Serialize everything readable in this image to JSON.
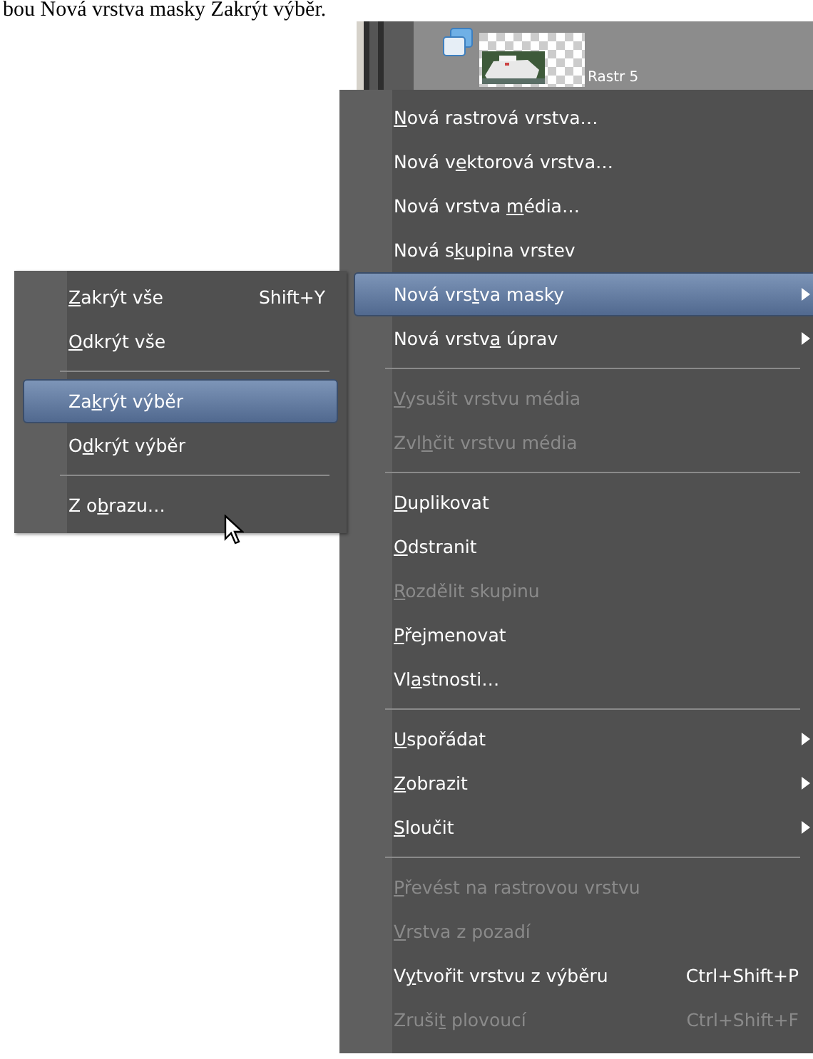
{
  "document_text": "bou Nová vrstva masky Zakrýt výběr.",
  "layer": {
    "name": "Rastr 5"
  },
  "context_menu": {
    "items": [
      {
        "kind": "item",
        "label": {
          "key": "N",
          "after": "ová rastrová vrstva…"
        },
        "disabled": false,
        "selected": false,
        "submenu": false
      },
      {
        "kind": "item",
        "label": {
          "before": "Nová v",
          "key": "e",
          "after": "ktorová vrstva…"
        },
        "disabled": false,
        "selected": false,
        "submenu": false
      },
      {
        "kind": "item",
        "label": {
          "before": "Nová vrstva ",
          "key": "m",
          "after": "édia…"
        },
        "disabled": false,
        "selected": false,
        "submenu": false
      },
      {
        "kind": "item",
        "label": {
          "before": "Nová s",
          "key": "k",
          "after": "upina vrstev"
        },
        "disabled": false,
        "selected": false,
        "submenu": false
      },
      {
        "kind": "item",
        "label": {
          "before": "Nová vrs",
          "key": "t",
          "after": "va masky"
        },
        "disabled": false,
        "selected": true,
        "submenu": true
      },
      {
        "kind": "item",
        "label": {
          "before": "Nová vrstv",
          "key": "a",
          "after": " úprav"
        },
        "disabled": false,
        "selected": false,
        "submenu": true
      },
      {
        "kind": "separator"
      },
      {
        "kind": "item",
        "label": {
          "key": "V",
          "after": "ysušit vrstvu média"
        },
        "disabled": true,
        "selected": false,
        "submenu": false
      },
      {
        "kind": "item",
        "label": {
          "before": "Zvl",
          "key": "h",
          "after": "čit vrstvu média"
        },
        "disabled": true,
        "selected": false,
        "submenu": false
      },
      {
        "kind": "separator"
      },
      {
        "kind": "item",
        "label": {
          "key": "D",
          "after": "uplikovat"
        },
        "disabled": false,
        "selected": false,
        "submenu": false
      },
      {
        "kind": "item",
        "label": {
          "key": "O",
          "after": "dstranit"
        },
        "disabled": false,
        "selected": false,
        "submenu": false
      },
      {
        "kind": "item",
        "label": {
          "key": "R",
          "after": "ozdělit skupinu"
        },
        "disabled": true,
        "selected": false,
        "submenu": false
      },
      {
        "kind": "item",
        "label": {
          "key": "P",
          "after": "řejmenovat"
        },
        "disabled": false,
        "selected": false,
        "submenu": false
      },
      {
        "kind": "item",
        "label": {
          "before": "Vl",
          "key": "a",
          "after": "stnosti…"
        },
        "disabled": false,
        "selected": false,
        "submenu": false
      },
      {
        "kind": "separator"
      },
      {
        "kind": "item",
        "label": {
          "key": "U",
          "after": "spořádat"
        },
        "disabled": false,
        "selected": false,
        "submenu": true
      },
      {
        "kind": "item",
        "label": {
          "key": "Z",
          "after": "obrazit"
        },
        "disabled": false,
        "selected": false,
        "submenu": true
      },
      {
        "kind": "item",
        "label": {
          "key": "S",
          "after": "loučit"
        },
        "disabled": false,
        "selected": false,
        "submenu": true
      },
      {
        "kind": "separator"
      },
      {
        "kind": "item",
        "label": {
          "key": "P",
          "after": "řevést na rastrovou vrstvu"
        },
        "disabled": true,
        "selected": false,
        "submenu": false
      },
      {
        "kind": "item",
        "label": {
          "key": "V",
          "after": "rstva z pozadí"
        },
        "disabled": true,
        "selected": false,
        "submenu": false
      },
      {
        "kind": "item",
        "label": {
          "before": "V",
          "key": "y",
          "after": "tvořit vrstvu z výběru"
        },
        "shortcut": "Ctrl+Shift+P",
        "disabled": false,
        "selected": false,
        "submenu": false
      },
      {
        "kind": "item",
        "label": {
          "before": "Zruši",
          "key": "t",
          "after": " plovoucí"
        },
        "shortcut": "Ctrl+Shift+F",
        "disabled": true,
        "selected": false,
        "submenu": false
      }
    ]
  },
  "submenu": {
    "items": [
      {
        "kind": "item",
        "label": {
          "key": "Z",
          "after": "akrýt vše"
        },
        "shortcut": "Shift+Y",
        "disabled": false,
        "selected": false
      },
      {
        "kind": "item",
        "label": {
          "key": "O",
          "after": "dkrýt vše"
        },
        "disabled": false,
        "selected": false
      },
      {
        "kind": "separator"
      },
      {
        "kind": "item",
        "label": {
          "before": "Za",
          "key": "k",
          "after": "rýt výběr"
        },
        "disabled": false,
        "selected": true
      },
      {
        "kind": "item",
        "label": {
          "before": "O",
          "key": "d",
          "after": "krýt výběr"
        },
        "disabled": false,
        "selected": false
      },
      {
        "kind": "separator"
      },
      {
        "kind": "item",
        "label": {
          "before": "Z o",
          "key": "b",
          "after": "razu…"
        },
        "disabled": false,
        "selected": false
      }
    ]
  }
}
